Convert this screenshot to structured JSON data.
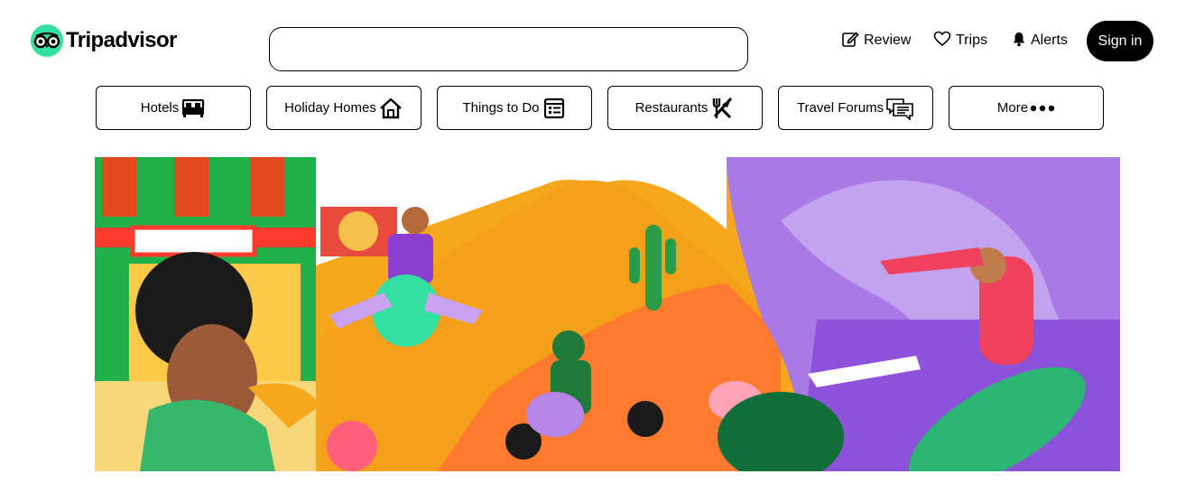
{
  "brand": {
    "name": "Tripadvisor",
    "accent": "#34e0a1"
  },
  "search": {
    "placeholder": "",
    "value": ""
  },
  "header": {
    "review_label": "Review",
    "trips_label": "Trips",
    "alerts_label": "Alerts",
    "signin_label": "Sign in"
  },
  "categories": [
    {
      "label": "Hotels",
      "icon": "bed-icon"
    },
    {
      "label": "Holiday Homes",
      "icon": "house-icon"
    },
    {
      "label": "Things to Do",
      "icon": "list-icon"
    },
    {
      "label": "Restaurants",
      "icon": "fork-knife-icon"
    },
    {
      "label": "Travel Forums",
      "icon": "chat-icon"
    },
    {
      "label": "More",
      "icon": "dots-icon"
    }
  ],
  "hero": {
    "description_colors": [
      "#00aa6c",
      "#f5a623",
      "#ff5a36",
      "#a97ae6"
    ]
  }
}
